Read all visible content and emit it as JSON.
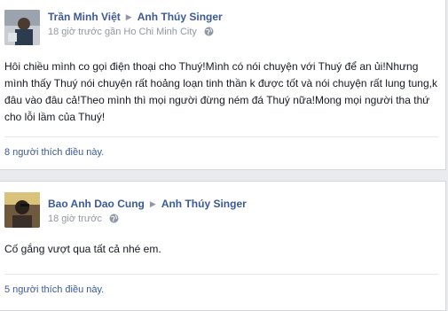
{
  "posts": [
    {
      "author": "Trần Minh Việt",
      "target": "Anh Thúy Singer",
      "time": "18 giờ trước",
      "location": "gần Ho Chi Minh City",
      "privacy_icon": "globe-icon",
      "text": "Hôi chiều mình co gọi điện thoại cho Thuý!Mình có nói chuyện với Thuý để an ủi!Nhưng mình thấy Thuý nói chuyện rất hoảng loạn tinh thần k được tốt và nói chuyện rất lung tung,k đâu vào đâu cả!Theo mình thì mọi người đừng ném đá Thuý nữa!Mong mọi người tha thứ cho lỗi lầm của Thuý!",
      "likes": "8 người thích điều này."
    },
    {
      "author": "Bao Anh Dao Cung",
      "target": "Anh Thúy Singer",
      "time": "18 giờ trước",
      "privacy_icon": "globe-icon",
      "text": "Cố gắng vượt qua tất cả nhé em.",
      "likes": "5 người thích điều này."
    }
  ],
  "colors": {
    "link": "#3b5998",
    "meta": "#9197a3",
    "text": "#141823",
    "background": "#e9ebee"
  }
}
